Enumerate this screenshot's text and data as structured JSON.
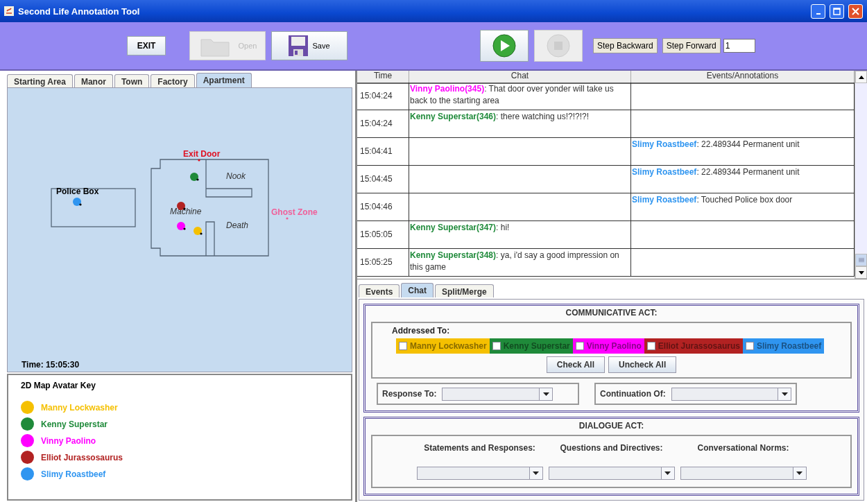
{
  "window": {
    "title": "Second Life Annotation Tool"
  },
  "toolbar": {
    "buttons": [
      {
        "kind": "text",
        "label": "EXIT",
        "disabled": false
      },
      {
        "kind": "open",
        "label": "Open",
        "disabled": true
      },
      {
        "kind": "save",
        "label": "Save",
        "disabled": false
      }
    ],
    "playback": [
      {
        "kind": "play",
        "disabled": false
      },
      {
        "kind": "stop",
        "disabled": true
      }
    ],
    "steps": [
      "Step Backward",
      "Step Forward"
    ],
    "step_value": "1"
  },
  "map_tabs": [
    {
      "label": "Starting Area",
      "selected": false
    },
    {
      "label": "Manor",
      "selected": false
    },
    {
      "label": "Town",
      "selected": false
    },
    {
      "label": "Factory",
      "selected": false
    },
    {
      "label": "Apartment",
      "selected": true
    }
  ],
  "map": {
    "labels": [
      {
        "label": "Exit Door",
        "kind": "marker",
        "color": "#e01020"
      },
      {
        "label": "Nook",
        "kind": "room"
      },
      {
        "label": "Police Box",
        "kind": "area"
      },
      {
        "label": "Machine",
        "kind": "room"
      },
      {
        "label": "Ghost Zone",
        "kind": "marker",
        "color": "#f0609a"
      },
      {
        "label": "Death",
        "kind": "room"
      }
    ],
    "avatars": [
      {
        "color": "#1f8a3a"
      },
      {
        "color": "#2f95f0"
      },
      {
        "color": "#b22222"
      },
      {
        "color": "#ff00ff"
      },
      {
        "color": "#f5c000"
      }
    ],
    "time": "Time: 15:05:30"
  },
  "legend": {
    "title": "2D Map Avatar Key",
    "items": [
      {
        "name": "Manny Lockwasher",
        "color": "#f5c000"
      },
      {
        "name": "Kenny Superstar",
        "color": "#1f8a3a"
      },
      {
        "name": "Vinny Paolino",
        "color": "#ff00ff"
      },
      {
        "name": "Elliot Jurassosaurus",
        "color": "#b22222"
      },
      {
        "name": "Slimy Roastbeef",
        "color": "#2f95f0"
      }
    ]
  },
  "table": {
    "columns": [
      "Time",
      "Chat",
      "Events/Annotations"
    ],
    "rows": [
      {
        "time": "15:04:24",
        "chat": {
          "speaker": "Vinny Paolino(345)",
          "color": "#ff00ff",
          "text": ": That door over yonder will take us back to the starting area"
        }
      },
      {
        "time": "15:04:24",
        "chat": {
          "speaker": "Kenny Superstar(346)",
          "color": "#1f8a3a",
          "text": ": there watching us!?!?!?!"
        }
      },
      {
        "time": "15:04:41",
        "event": {
          "actor": "Slimy Roastbeef",
          "color": "#2f95f0",
          "text": ": 22.489344 Permanent unit"
        }
      },
      {
        "time": "15:04:45",
        "event": {
          "actor": "Slimy Roastbeef",
          "color": "#2f95f0",
          "text": ": 22.489344 Permanent unit"
        }
      },
      {
        "time": "15:04:46",
        "event": {
          "actor": "Slimy Roastbeef",
          "color": "#2f95f0",
          "text": ": Touched Police box door"
        }
      },
      {
        "time": "15:05:05",
        "chat": {
          "speaker": "Kenny Superstar(347)",
          "color": "#1f8a3a",
          "text": ": hi!"
        }
      },
      {
        "time": "15:05:25",
        "chat": {
          "speaker": "Kenny Superstar(348)",
          "color": "#1f8a3a",
          "text": ": ya, i'd say a good impression on this game"
        }
      }
    ]
  },
  "annotation_tabs": [
    {
      "label": "Events",
      "selected": false
    },
    {
      "label": "Chat",
      "selected": true
    },
    {
      "label": "Split/Merge",
      "selected": false
    }
  ],
  "communicative_act": {
    "title": "COMMUNICATIVE ACT:",
    "addressed_label": "Addressed To:",
    "addressees": [
      {
        "name": "Manny Lockwasher",
        "color": "#f5c000",
        "checked": false
      },
      {
        "name": "Kenny Superstar",
        "color": "#1f8a3a",
        "checked": false
      },
      {
        "name": "Vinny Paolino",
        "color": "#ff00ff",
        "checked": false
      },
      {
        "name": "Elliot Jurassosaurus",
        "color": "#b22222",
        "checked": false
      },
      {
        "name": "Slimy Roastbeef",
        "color": "#2f95f0",
        "checked": false
      }
    ],
    "buttons": [
      "Check All",
      "Uncheck All"
    ],
    "response_to": "Response To:",
    "continuation_of": "Continuation Of:"
  },
  "dialogue_act": {
    "title": "DIALOGUE ACT:",
    "columns": [
      "Statements and Responses:",
      "Questions and Directives:",
      "Conversational Norms:"
    ]
  }
}
